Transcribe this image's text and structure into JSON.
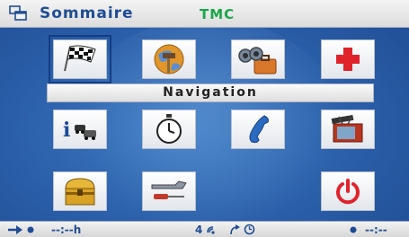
{
  "header": {
    "title": "Sommaire",
    "status": "TMC",
    "menu_icon": "window-menu-icon"
  },
  "selected_label": "Navigation",
  "tiles": [
    {
      "name": "navigation-tile",
      "icon": "checkered-flag-icon",
      "selected": true
    },
    {
      "name": "destination-tile",
      "icon": "globe-signpost-icon"
    },
    {
      "name": "travel-tile",
      "icon": "binoculars-suitcase-icon"
    },
    {
      "name": "emergency-tile",
      "icon": "red-cross-icon"
    },
    {
      "name": "info-traffic-tile",
      "icon": "info-traffic-icon"
    },
    {
      "name": "timer-tile",
      "icon": "stopwatch-icon"
    },
    {
      "name": "phone-tile",
      "icon": "phone-handset-icon"
    },
    {
      "name": "multimedia-tile",
      "icon": "tv-clapper-icon"
    },
    {
      "name": "treasure-tile",
      "icon": "treasure-chest-icon"
    },
    {
      "name": "settings-tile",
      "icon": "wrench-screwdriver-icon"
    },
    {
      "name": "power-tile",
      "icon": "power-icon"
    }
  ],
  "footer": {
    "eta": "--:--h",
    "satellites": "4",
    "remaining": "--:--"
  },
  "colors": {
    "accent": "#1f4c93",
    "tmc": "#1aa64a",
    "background": "#2e64ad",
    "emergency": "#e0232b"
  }
}
